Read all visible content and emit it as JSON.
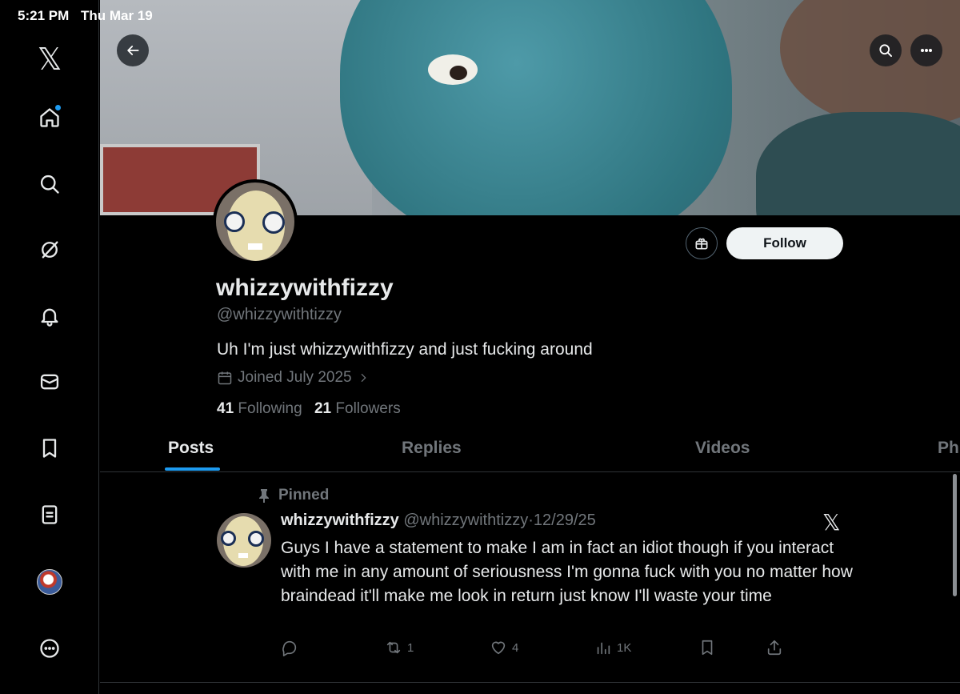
{
  "status_bar": {
    "time": "5:21 PM",
    "date": "Thu Mar 19"
  },
  "sidebar": {
    "items": [
      {
        "name": "logo",
        "icon": "x-logo-icon"
      },
      {
        "name": "home",
        "icon": "home-icon",
        "has_dot": true
      },
      {
        "name": "explore",
        "icon": "search-icon"
      },
      {
        "name": "grok",
        "icon": "grok-icon"
      },
      {
        "name": "notifications",
        "icon": "bell-icon"
      },
      {
        "name": "messages",
        "icon": "envelope-icon"
      },
      {
        "name": "bookmarks",
        "icon": "bookmark-icon"
      },
      {
        "name": "lists",
        "icon": "list-icon"
      },
      {
        "name": "profile",
        "icon": "avatar"
      },
      {
        "name": "more",
        "icon": "more-icon"
      }
    ]
  },
  "profile": {
    "display_name": "whizzywithfizzy",
    "handle": "@whizzywithtizzy",
    "bio": "Uh I'm just whizzywithfizzy and just fucking around",
    "joined": "Joined July 2025",
    "following_count": "41",
    "following_label": "Following",
    "followers_count": "21",
    "followers_label": "Followers",
    "follow_label": "Follow"
  },
  "tabs": [
    {
      "label": "Posts",
      "active": true
    },
    {
      "label": "Replies",
      "active": false
    },
    {
      "label": "Videos",
      "active": false
    },
    {
      "label": "Ph",
      "active": false
    }
  ],
  "pinned_post": {
    "pinned_label": "Pinned",
    "author_name": "whizzywithfizzy",
    "author_handle": "@whizzywithtizzy",
    "separator": "·",
    "date": "12/29/25",
    "text": "Guys I have a statement to make I am in fact an idiot though if you interact with me in any amount of seriousness I'm gonna fuck with you no matter how braindead it'll make me look in return just know I'll waste your time",
    "reposts": "1",
    "likes": "4",
    "views": "1K"
  },
  "colors": {
    "accent": "#1d9bf0",
    "muted": "#71767b",
    "text": "#e7e9ea",
    "background": "#000000"
  }
}
